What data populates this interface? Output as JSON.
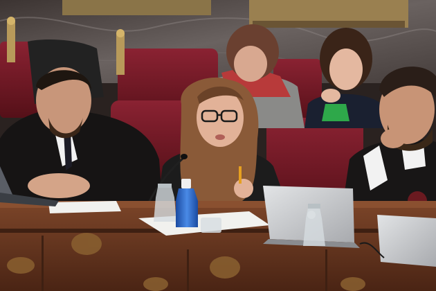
{
  "scene": {
    "description_label": "courtroom-scene",
    "colors": {
      "marble_wall": "#5a5452",
      "gilded_trim": "#b89a5a",
      "red_upholstery": "#7a1f2a",
      "dark_red_upholstery": "#5a1620",
      "wood_bench": "#6b3a22",
      "wood_dark": "#3e2012",
      "robe_black": "#161414",
      "skin": "#d9a98c",
      "hair_brown": "#7a5438",
      "hair_dark": "#2a1e18",
      "water_bottle_blue": "#2a64c8",
      "laptop_silver": "#c9cbcf",
      "paper_white": "#f1f1ee"
    }
  }
}
